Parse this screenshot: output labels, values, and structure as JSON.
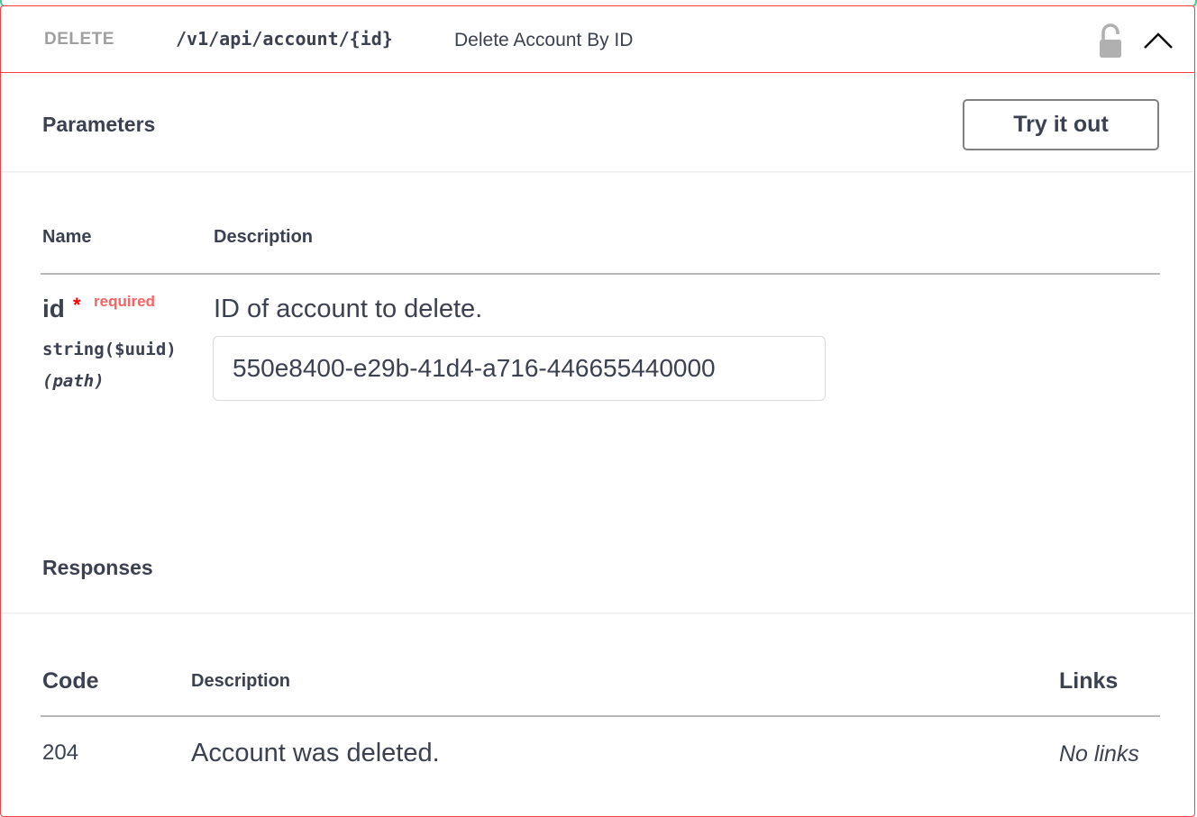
{
  "operation": {
    "method": "DELETE",
    "path": "/v1/api/account/{id}",
    "summary": "Delete Account By ID",
    "lock_icon": "lock-open-icon",
    "collapse_icon": "chevron-up-icon"
  },
  "parameters": {
    "title": "Parameters",
    "try_button": "Try it out",
    "columns": {
      "name": "Name",
      "description": "Description"
    },
    "items": [
      {
        "name": "id",
        "required_star": "*",
        "required_label": "required",
        "type": "string($uuid)",
        "location": "(path)",
        "description": "ID of account to delete.",
        "value": "550e8400-e29b-41d4-a716-446655440000"
      }
    ]
  },
  "responses": {
    "title": "Responses",
    "columns": {
      "code": "Code",
      "description": "Description",
      "links": "Links"
    },
    "items": [
      {
        "code": "204",
        "description": "Account was deleted.",
        "links": "No links"
      }
    ]
  },
  "colors": {
    "delete_border": "#f93e3e",
    "required": "#ff0000",
    "text": "#3b4151",
    "method_text": "#a0a0a0"
  }
}
